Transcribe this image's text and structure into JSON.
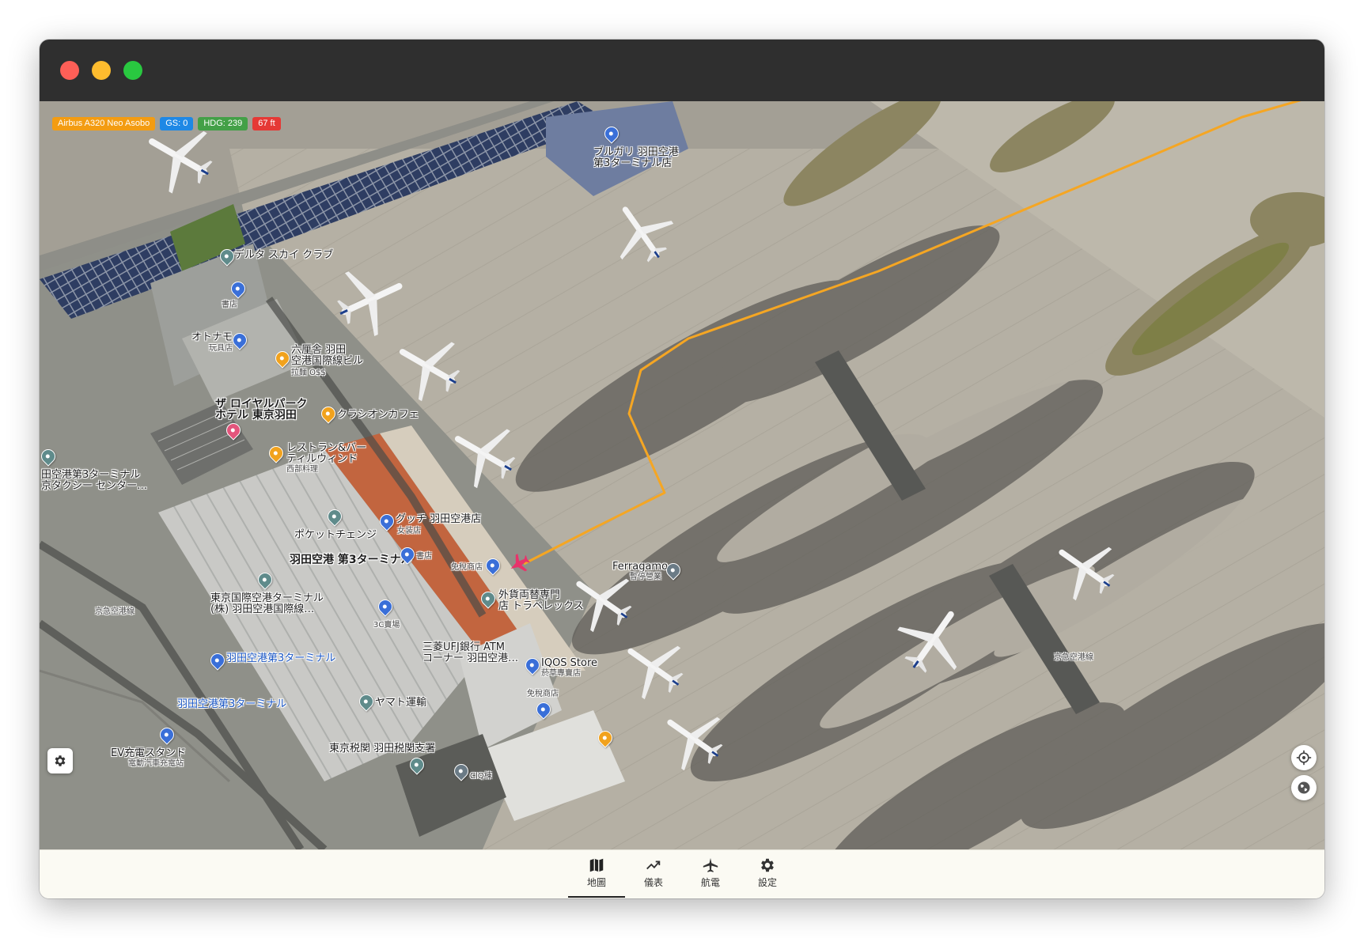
{
  "hud": {
    "aircraft": "Airbus A320 Neo Asobo",
    "gs": "GS: 0",
    "hdg": "HDG: 239",
    "alt": "67 ft"
  },
  "map_labels": {
    "bulgari": "ブルガリ 羽田空港\n第3ターミナル店",
    "delta": "デルタ スカイ クラブ",
    "bookstore1": "書店",
    "otonamo": "オトナモ",
    "toy": "玩具店",
    "rokurinsha": "六厘舎 羽田\n空港国際線ビル",
    "ramen": "拉麵 O$$",
    "royalpark": "ザ ロイヤルパーク\nホテル 東京羽田",
    "classic_cafe": "クラシオンカフェ",
    "restaurant": "レストラン&バー\nティルウィンド",
    "western": "西部料理",
    "terminal3_taxi": "田空港第3ターミナル\n京タクシー センター…",
    "pocket": "ポケットチェンジ",
    "gucci": "グッチ 羽田空港店",
    "clothing": "女装店",
    "terminal3": "羽田空港 第3ターミナル",
    "bookstore2": "書店",
    "dutyfree1": "免稅商店",
    "ferragamo": "Ferragamo",
    "closed": "暫停營業",
    "tokyo_intl": "東京国際空港ターミナル\n(株) 羽田空港国際線…",
    "exchange": "外貨両替専門\n店 トラベレックス",
    "keikyu1": "京急空港線",
    "three_c": "3C賣場",
    "mufg": "三菱UFJ銀行 ATM\nコーナー 羽田空港…",
    "iqos": "IQOS Store",
    "tobacco": "菸草專賣店",
    "station1": "羽田空港第3ターミナル",
    "dutyfree2": "免稅商店",
    "yamato": "ヤマト運輸",
    "station2": "羽田空港第3ターミナル",
    "ev": "EV充電スタンド",
    "ev_sub": "電動汽車充電站",
    "customs": "東京税関 羽田税関支署",
    "ciq": "CIQ棟",
    "keikyu2": "京急空港線"
  },
  "tabs": [
    {
      "label": "地圖",
      "icon": "map-icon",
      "active": true
    },
    {
      "label": "儀表",
      "icon": "trend-icon",
      "active": false
    },
    {
      "label": "航電",
      "icon": "airplane-icon",
      "active": false
    },
    {
      "label": "設定",
      "icon": "gear-icon",
      "active": false
    }
  ],
  "colors": {
    "route": "#f5a623",
    "aircraft_marker": "#e8336b",
    "titlebar": "#2f2f2f",
    "tabbar": "#fbfaf3"
  }
}
